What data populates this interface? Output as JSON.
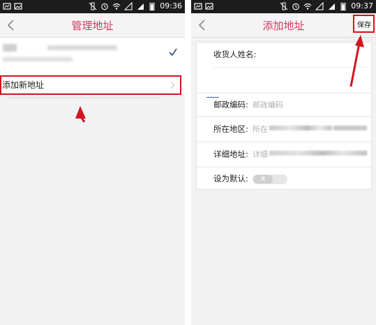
{
  "left_screen": {
    "status": {
      "time": "09:36"
    },
    "title": "管理地址",
    "add_new_address": "添加新地址"
  },
  "right_screen": {
    "status": {
      "time": "09:37"
    },
    "title": "添加地址",
    "save_label": "保存",
    "form": {
      "receiver_name_label": "收货人姓名:",
      "postcode_label": "邮政编码:",
      "postcode_placeholder": "邮政编码",
      "region_label": "所在地区:",
      "region_placeholder": "所在",
      "detail_label": "详细地址:",
      "detail_placeholder": "详细",
      "default_label": "设为默认:",
      "default_toggle_text": "关"
    }
  },
  "colors": {
    "accent": "#d0395f",
    "highlight_box": "#d0151e",
    "status_bar": "#1c1c1c"
  }
}
